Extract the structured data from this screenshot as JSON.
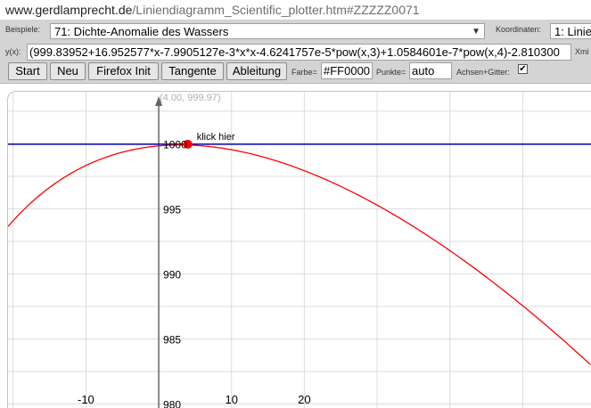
{
  "url": {
    "host": "www.gerdlamprecht.de",
    "path": "/Liniendiagramm_Scientific_plotter.htm#ZZZZZ0071"
  },
  "toolbar": {
    "examples_label": "Beispiele:",
    "examples_selected": "71: Dichte-Anomalie des Wassers",
    "coords_label": "Koordinaten:",
    "coords_selected": "1: Linie",
    "formula_label": "y(x):",
    "formula_value": "(999.83952+16.952577*x-7.9905127e-3*x*x-4.6241757e-5*pow(x,3)+1.0584601e-7*pow(x,4)-2.810300",
    "xmin_label": "Xmi",
    "buttons": {
      "start": "Start",
      "neu": "Neu",
      "firefox": "Firefox Init",
      "tangente": "Tangente",
      "ableitung": "Ableitung"
    },
    "color_label": "Farbe=",
    "color_value": "#FF0000",
    "points_label": "Punkte=",
    "points_value": "auto",
    "grid_label": "Achsen+Gitter:",
    "grid_checked": "✔"
  },
  "plot": {
    "max_point_label": "(4.00, 999.97)",
    "click_label": "klick hier",
    "curve_color": "#ff0000",
    "line_color": "#0000b0",
    "grid_color": "#dcdcdc",
    "point_color": "#ff0000"
  },
  "chart_data": {
    "type": "line",
    "xlim": [
      -20.7,
      59.5
    ],
    "ylim": [
      979.7,
      1004.0
    ],
    "y_ticks": [
      980,
      985,
      990,
      995,
      1000
    ],
    "x_ticks": [
      -10,
      10,
      20
    ],
    "grid": true,
    "formula": "(999.83952+16.952577*x-7.9905127e-3*x*x-4.6241757e-5*pow(x,3)+1.0584601e-7*pow(x,4)-2.810300",
    "max_point": {
      "x": 4.0,
      "y": 999.97
    },
    "horizontal_line_y": 999.97
  }
}
